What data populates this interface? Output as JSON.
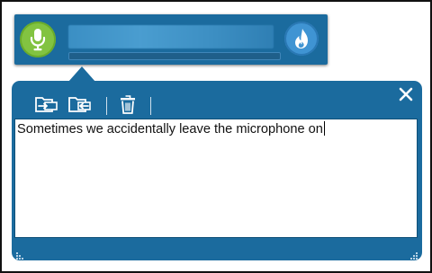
{
  "dictation_bar": {
    "mic_icon": "microphone-icon",
    "dragon_icon": "dragon-flame-icon",
    "recognition_text": "",
    "level_meter_value": 0.0
  },
  "dictation_box": {
    "toolbar": {
      "insert_icon": "insert-text-icon",
      "transfer_icon": "transfer-text-icon",
      "delete_icon": "trash-icon"
    },
    "close_icon": "close-icon",
    "text": "Sometimes we accidentally leave the microphone on",
    "grip_icon": "resize-grip-icon"
  },
  "colors": {
    "bar_blue": "#1b6b9e",
    "mic_green": "#82c341",
    "dragon_blue": "#3f94d3",
    "text_bg": "#ffffff"
  }
}
